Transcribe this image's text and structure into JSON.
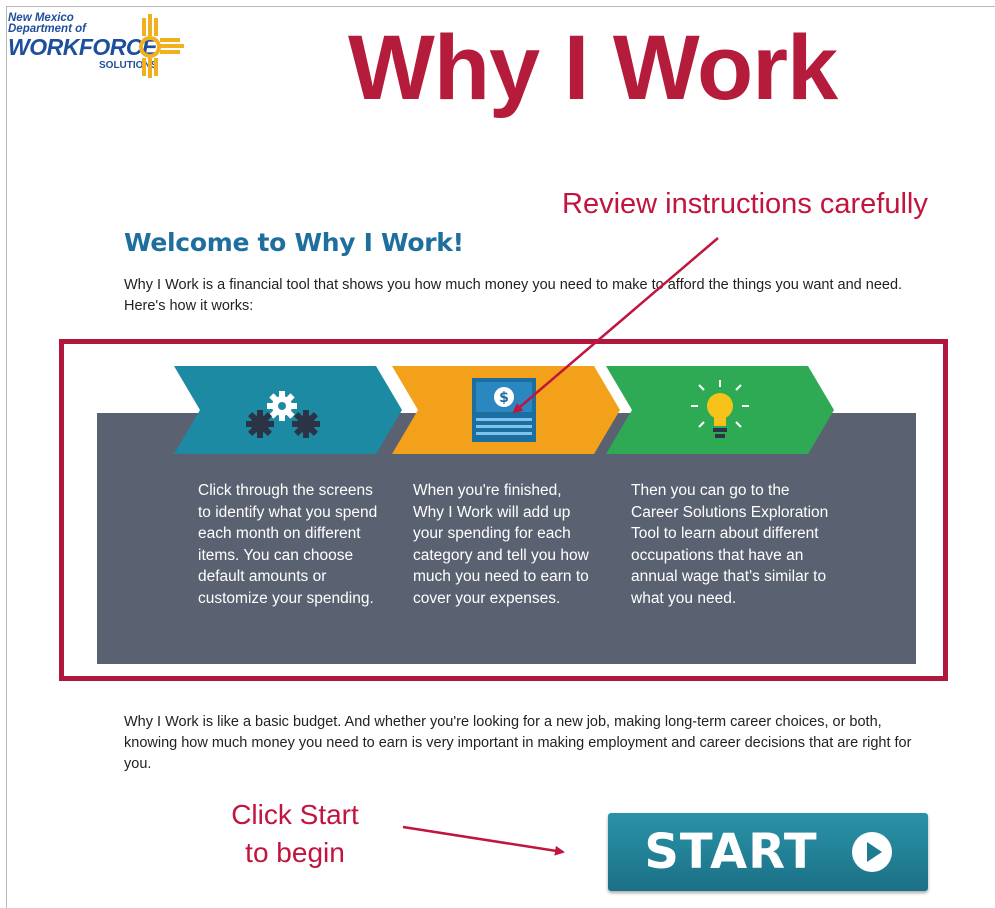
{
  "logo": {
    "line1": "New Mexico",
    "line2": "Department of",
    "line3": "WORKFORCE",
    "line4": "SOLUTIONS"
  },
  "header": {
    "title": "Why I Work"
  },
  "annotations": {
    "review": "Review instructions carefully",
    "click_start_line1": "Click Start",
    "click_start_line2": "to begin",
    "accent_color": "#c1143e"
  },
  "welcome": {
    "heading": "Welcome to Why I Work!",
    "intro": "Why I Work is a financial tool that shows you how much money you need to make to afford the things you want and need. Here's how it works:"
  },
  "steps": [
    {
      "icon": "gears-icon",
      "color": "#1d8aa3",
      "text": "Click through the screens to identify what you spend each month on different items. You can choose default amounts or customize your spending."
    },
    {
      "icon": "money-icon",
      "color": "#f3a11b",
      "text": "When you're finished, Why I Work will add up your spending for each category and tell you how much you need to earn to cover your expenses."
    },
    {
      "icon": "lightbulb-icon",
      "color": "#2eaa55",
      "text": "Then you can go to the Career Solutions Exploration Tool to learn about different occupations that have an annual wage that's similar to what you need."
    }
  ],
  "body": {
    "paragraph": "Why I Work is like a basic budget.  And whether you're looking for a new job, making long-term career choices, or both, knowing how much money you need to earn is very important in making employment and career decisions that are right for you."
  },
  "start_button": {
    "label": "START",
    "icon": "play-circle-icon",
    "color": "#1f7b91"
  }
}
